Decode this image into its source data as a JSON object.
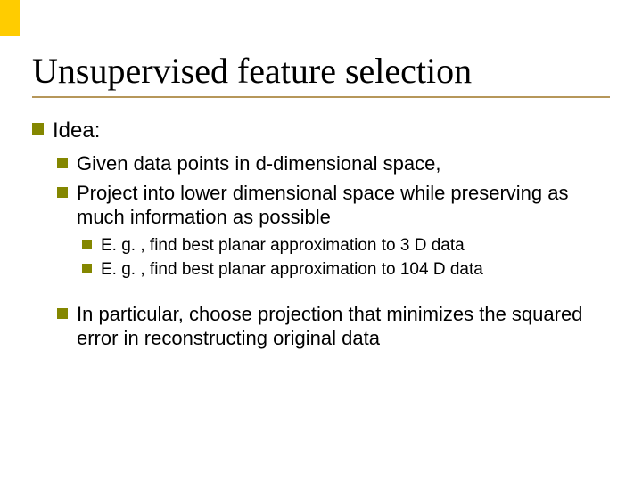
{
  "title": "Unsupervised feature selection",
  "idea_label": "Idea:",
  "sub1": "Given data points in d-dimensional space,",
  "sub2": "Project into lower dimensional space while preserving as much information as possible",
  "eg1": "E. g. , find best planar approximation to 3 D data",
  "eg2": "E. g. , find best planar approximation to 104 D data",
  "sub3": "In particular, choose projection that minimizes the squared error in reconstructing original data"
}
